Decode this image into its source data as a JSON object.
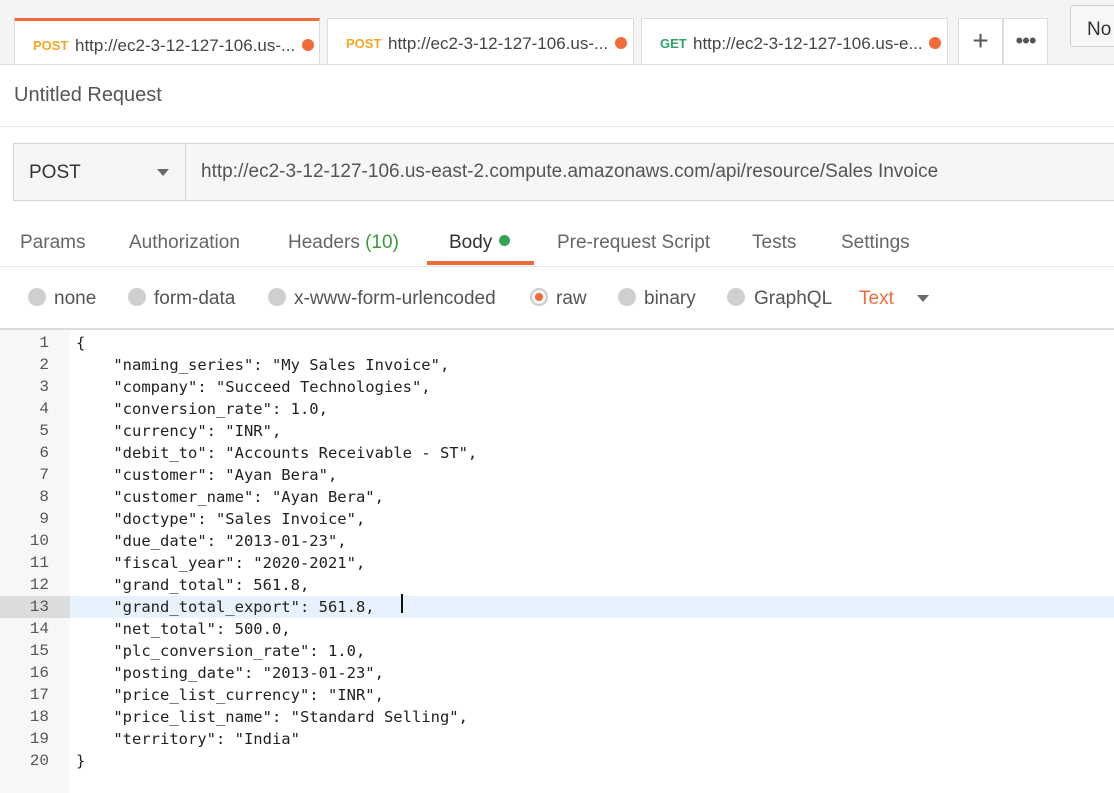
{
  "tabs": [
    {
      "method": "POST",
      "method_color": "#f5a623",
      "url": "http://ec2-3-12-127-106.us-...",
      "unsaved_color": "#f26b3a",
      "active": true
    },
    {
      "method": "POST",
      "method_color": "#f5a623",
      "url": "http://ec2-3-12-127-106.us-...",
      "unsaved_color": "#f26b3a",
      "active": false
    },
    {
      "method": "GET",
      "method_color": "#2fa36b",
      "url": "http://ec2-3-12-127-106.us-e...",
      "unsaved_color": "#f26b3a",
      "active": false
    }
  ],
  "tab_actions": {
    "new_icon": "plus-icon",
    "new_label": "+",
    "more_icon": "more-icon",
    "more_label": "•••"
  },
  "environment": {
    "label": "No"
  },
  "request": {
    "title": "Untitled Request",
    "method": "POST",
    "url": "http://ec2-3-12-127-106.us-east-2.compute.amazonaws.com/api/resource/Sales Invoice"
  },
  "subtabs": {
    "params": "Params",
    "authorization": "Authorization",
    "headers": "Headers",
    "headers_count": "(10)",
    "body": "Body",
    "prerequest": "Pre-request Script",
    "tests": "Tests",
    "settings": "Settings",
    "active": "Body",
    "accent_color": "#f26b3a",
    "body_indicator_color": "#36a357"
  },
  "body_types": {
    "options": [
      "none",
      "form-data",
      "x-www-form-urlencoded",
      "raw",
      "binary",
      "GraphQL"
    ],
    "selected": "raw",
    "format": "Text"
  },
  "editor": {
    "current_line": 13,
    "lines": [
      "{",
      "    \"naming_series\": \"My Sales Invoice\",",
      "    \"company\": \"Succeed Technologies\",",
      "    \"conversion_rate\": 1.0,",
      "    \"currency\": \"INR\",",
      "    \"debit_to\": \"Accounts Receivable - ST\",",
      "    \"customer\": \"Ayan Bera\",",
      "    \"customer_name\": \"Ayan Bera\",",
      "    \"doctype\": \"Sales Invoice\",",
      "    \"due_date\": \"2013-01-23\",",
      "    \"fiscal_year\": \"2020-2021\",",
      "    \"grand_total\": 561.8,",
      "    \"grand_total_export\": 561.8, ",
      "    \"net_total\": 500.0,",
      "    \"plc_conversion_rate\": 1.0,",
      "    \"posting_date\": \"2013-01-23\",",
      "    \"price_list_currency\": \"INR\",",
      "    \"price_list_name\": \"Standard Selling\",",
      "    \"territory\": \"India\"",
      "}"
    ]
  }
}
